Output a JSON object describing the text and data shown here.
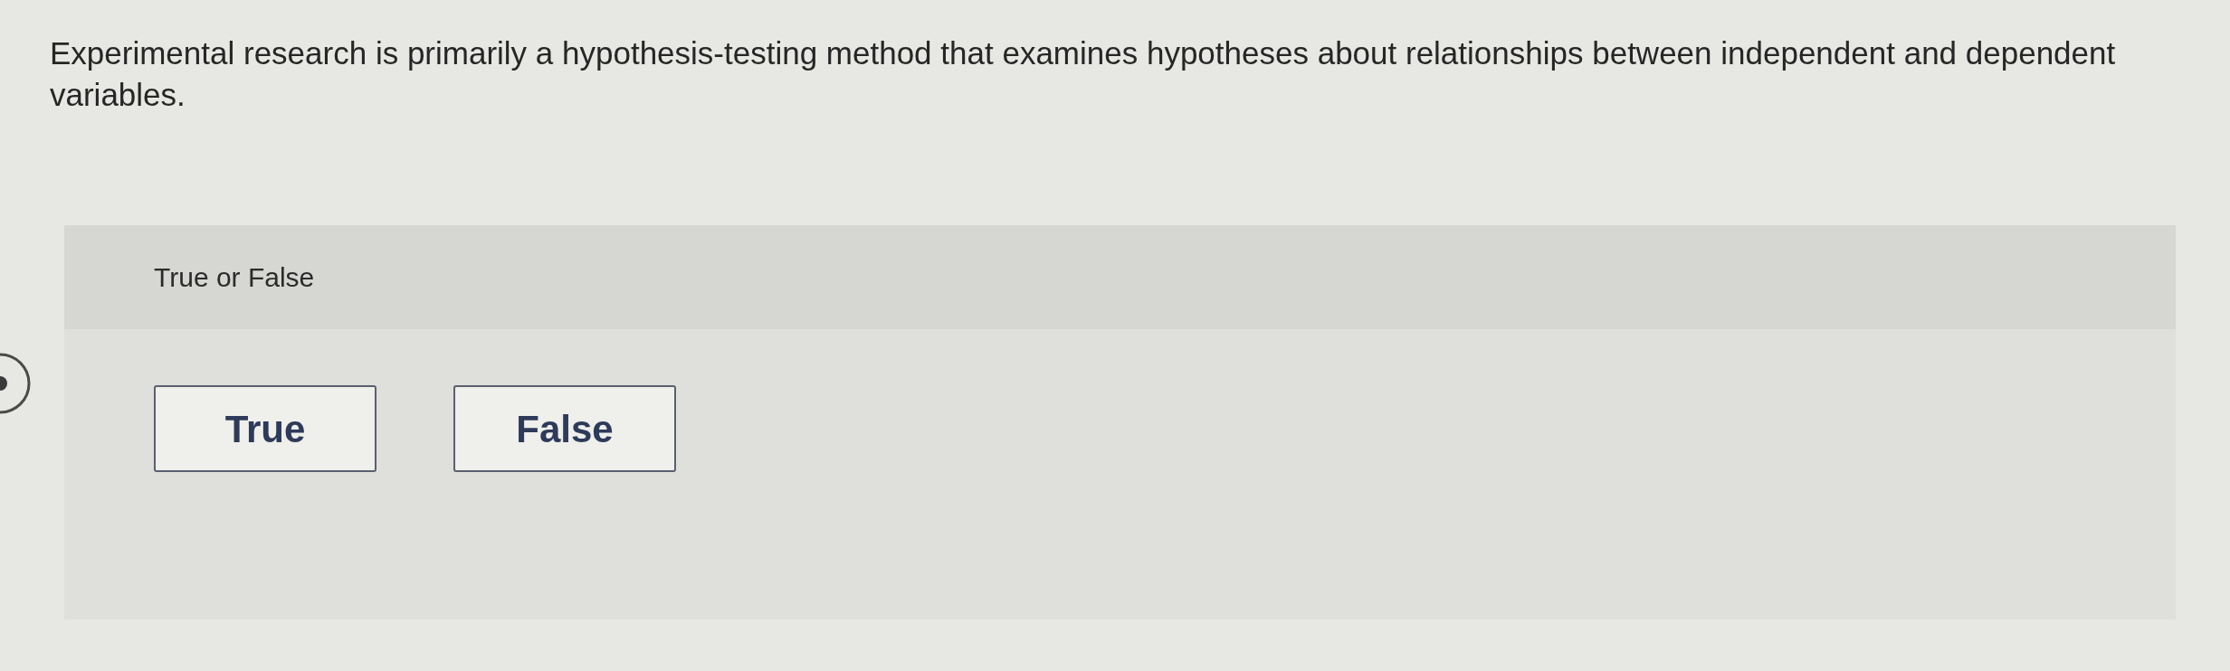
{
  "question": {
    "text": "Experimental research is primarily a hypothesis-testing method that examines hypotheses about relationships between independent and dependent variables."
  },
  "answer_panel": {
    "prompt": "True or False",
    "options": [
      {
        "label": "True",
        "selected": false
      },
      {
        "label": "False",
        "selected": false
      }
    ]
  }
}
